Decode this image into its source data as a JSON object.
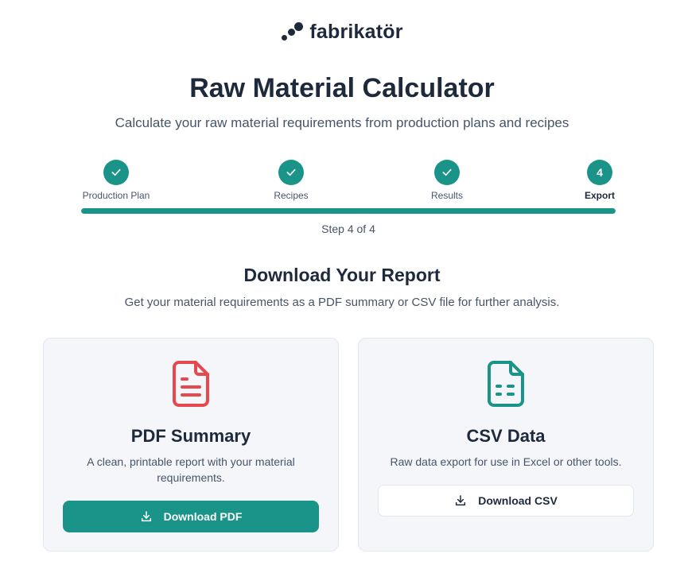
{
  "brand": {
    "name": "fabrikatör"
  },
  "header": {
    "title": "Raw Material Calculator",
    "subtitle": "Calculate your raw material requirements from production plans and recipes"
  },
  "stepper": {
    "steps": [
      {
        "label": "Production Plan",
        "status": "complete",
        "icon": "check-icon"
      },
      {
        "label": "Recipes",
        "status": "complete",
        "icon": "check-icon"
      },
      {
        "label": "Results",
        "status": "complete",
        "icon": "check-icon"
      },
      {
        "label": "Export",
        "status": "current",
        "number": "4"
      }
    ],
    "progress": 1.0,
    "step_text": "Step 4 of 4"
  },
  "section": {
    "title": "Download Your Report",
    "description": "Get your material requirements as a PDF summary or CSV file for further analysis."
  },
  "cards": {
    "pdf": {
      "icon": "file-text-icon",
      "title": "PDF Summary",
      "description": "A clean, printable report with your material requirements.",
      "button": "Download PDF"
    },
    "csv": {
      "icon": "file-spreadsheet-icon",
      "title": "CSV Data",
      "description": "Raw data export for use in Excel or other tools.",
      "button": "Download CSV"
    }
  },
  "colors": {
    "accent": "#1a9488",
    "pdf_icon": "#e5484d",
    "csv_icon": "#1a9488",
    "text": "#1e293b",
    "muted": "#475569"
  }
}
